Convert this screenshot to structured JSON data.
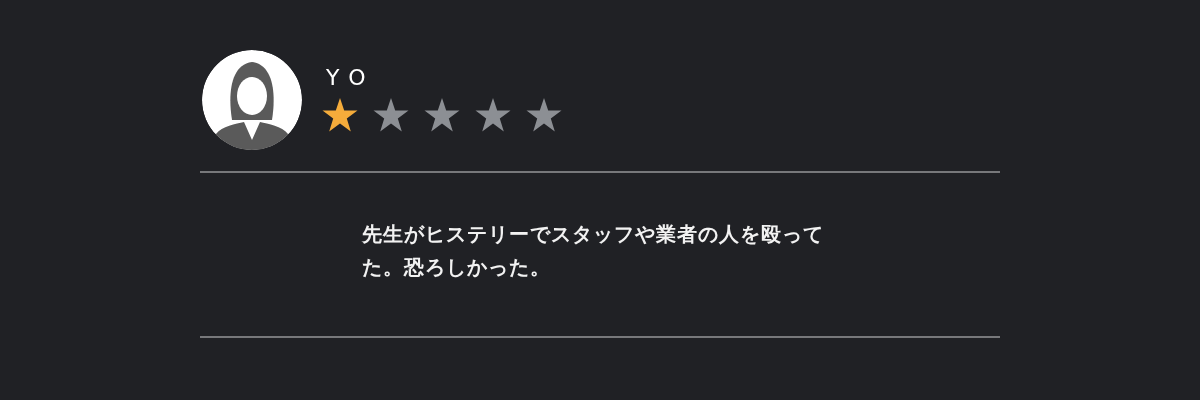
{
  "review": {
    "name": "YO",
    "stars": 1,
    "comment": "先生がヒステリーでスタッフや業者の人を殴ってた。恐ろしかった。"
  }
}
